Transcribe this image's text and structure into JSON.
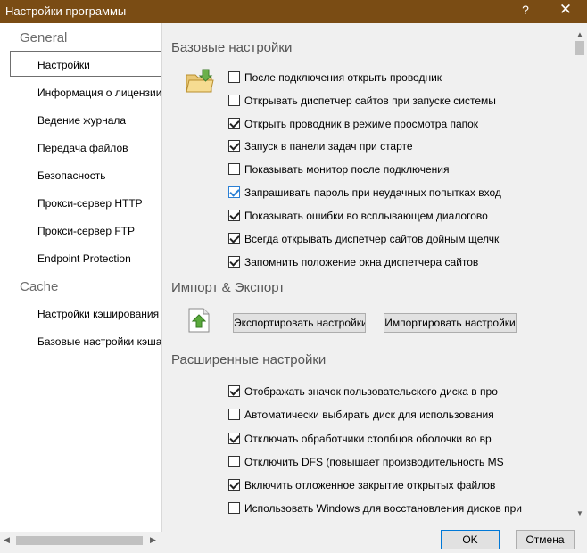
{
  "window": {
    "title": "Настройки программы",
    "help_glyph": "?",
    "close_glyph": "✕"
  },
  "sidebar": {
    "groups": [
      "General",
      "Cache"
    ],
    "items": [
      "Настройки",
      "Информация о лицензии",
      "Ведение журнала",
      "Передача файлов",
      "Безопасность",
      "Прокси-сервер HTTP",
      "Прокси-сервер FTP",
      "Endpoint Protection",
      "Настройки кэширования",
      "Базовые настройки кэша"
    ],
    "selected": "Настройки"
  },
  "sections": {
    "basic": {
      "title": "Базовые настройки",
      "icon": "folder-icon",
      "options": [
        {
          "label": "После подключения открыть проводник",
          "checked": false
        },
        {
          "label": "Открывать диспетчер сайтов при запуске системы",
          "checked": false
        },
        {
          "label": "Открыть проводник в режиме просмотра папок",
          "checked": true
        },
        {
          "label": "Запуск в панели задач при старте",
          "checked": true
        },
        {
          "label": "Показывать монитор после подключения",
          "checked": false
        },
        {
          "label": "Запрашивать пароль при неудачных попытках вход",
          "checked": true
        },
        {
          "label": "Показывать ошибки во всплывающем диалогово",
          "checked": true
        },
        {
          "label": "Всегда открывать диспетчер сайтов дойным щелчк",
          "checked": true
        },
        {
          "label": "Запомнить положение окна диспетчера сайтов",
          "checked": true
        }
      ]
    },
    "import_export": {
      "title": "Импорт & Экспорт",
      "icon": "export-icon",
      "export_label": "Экспортировать настройки",
      "import_label": "Импортировать настройки"
    },
    "advanced": {
      "title": "Расширенные настройки",
      "options": [
        {
          "label": "Отображать значок пользовательского диска в про",
          "checked": true
        },
        {
          "label": "Автоматически выбирать диск для использования",
          "checked": false
        },
        {
          "label": "Отключать обработчики столбцов оболочки во вр",
          "checked": true
        },
        {
          "label": "Отключить DFS (повышает производительность MS",
          "checked": false
        },
        {
          "label": "Включить отложенное закрытие открытых файлов",
          "checked": true
        },
        {
          "label": "Использовать Windows для восстановления дисков при",
          "checked": false
        }
      ]
    }
  },
  "footer": {
    "ok_label": "OK",
    "cancel_label": "Отмена"
  },
  "colors": {
    "titlebar": "#7a4c14",
    "accent": "#0078d7"
  }
}
